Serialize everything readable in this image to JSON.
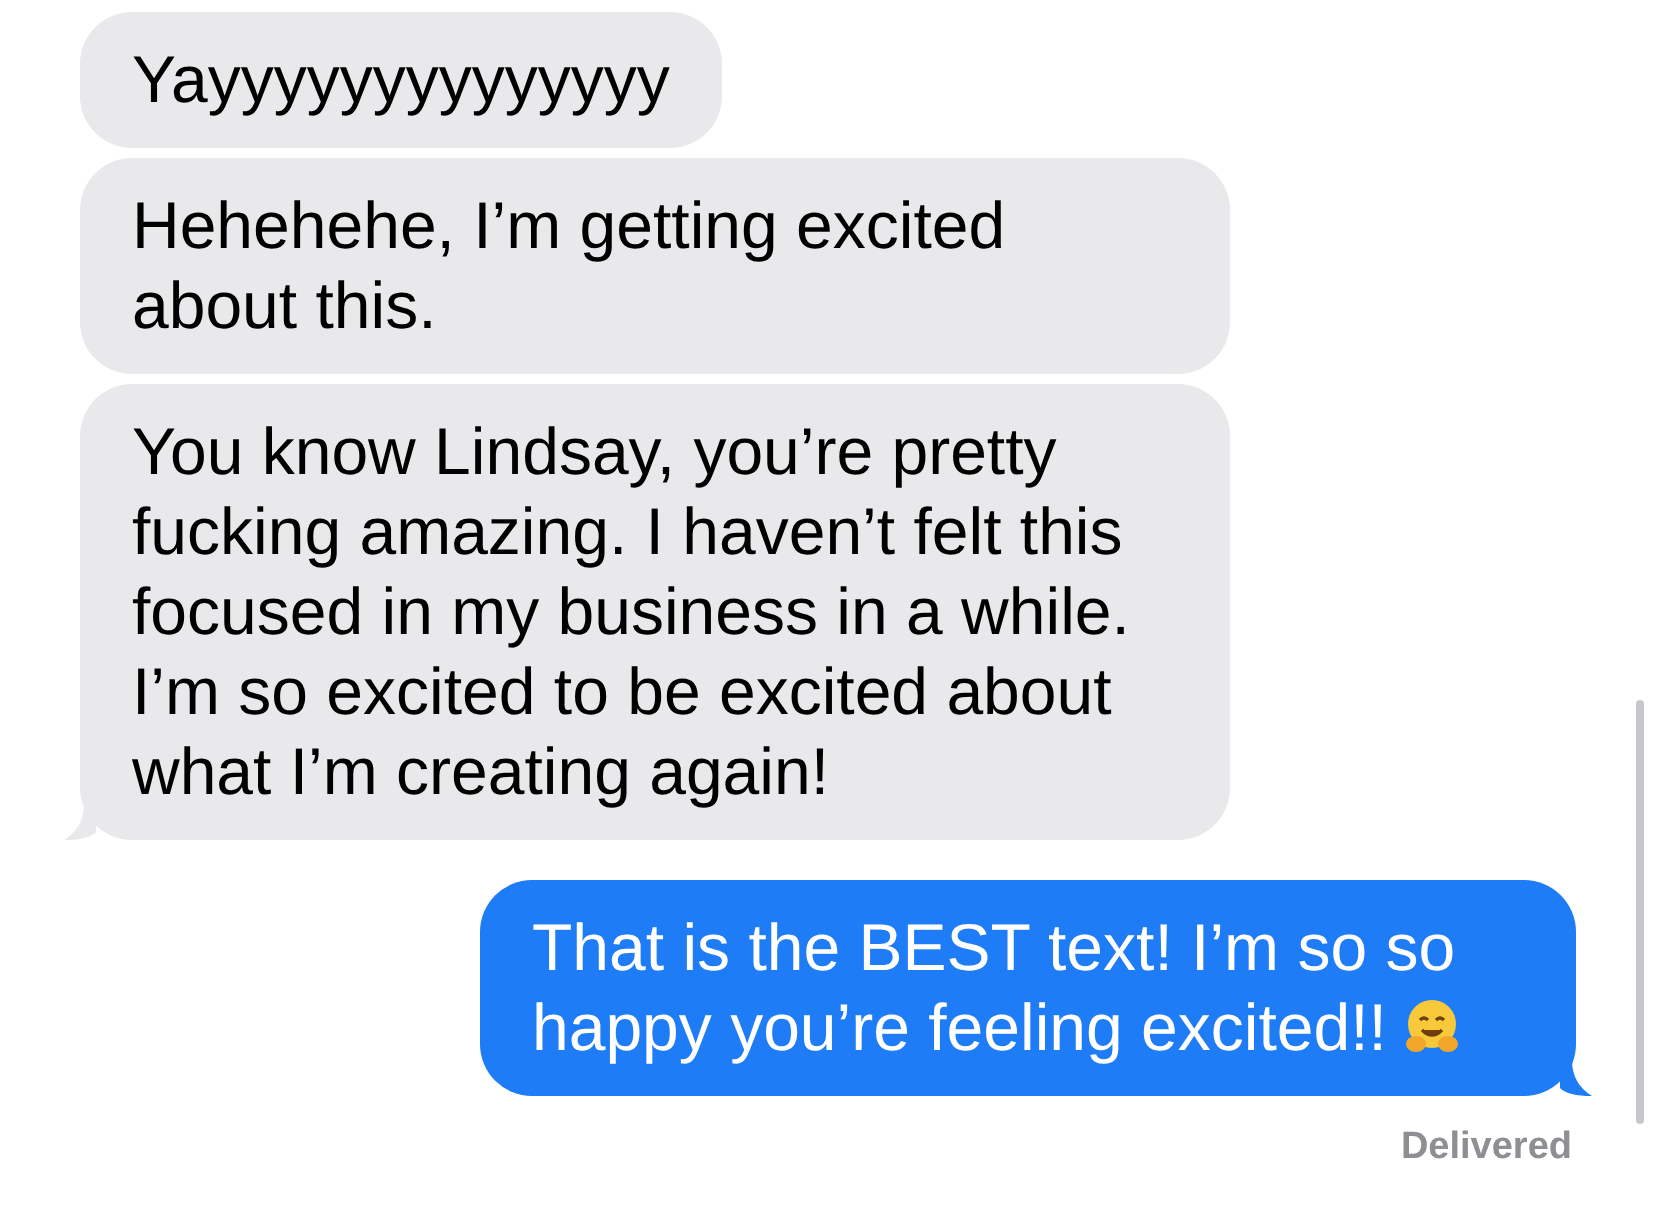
{
  "messages": [
    {
      "kind": "received",
      "text": "Yayyyyyyyyyyyyyy",
      "tail": false
    },
    {
      "kind": "received",
      "text": "Hehehehe, I’m getting excited about this.",
      "tail": false
    },
    {
      "kind": "received",
      "text": "You know Lindsay, you’re pretty fucking amazing. I haven’t felt this focused in my business in a while. I’m so excited to be excited about what I’m creating again!",
      "tail": true
    },
    {
      "kind": "sent",
      "text": "That is the BEST text! I’m so so happy you’re feeling excited!!",
      "emoji": true,
      "tail": true
    }
  ],
  "status": "Delivered"
}
